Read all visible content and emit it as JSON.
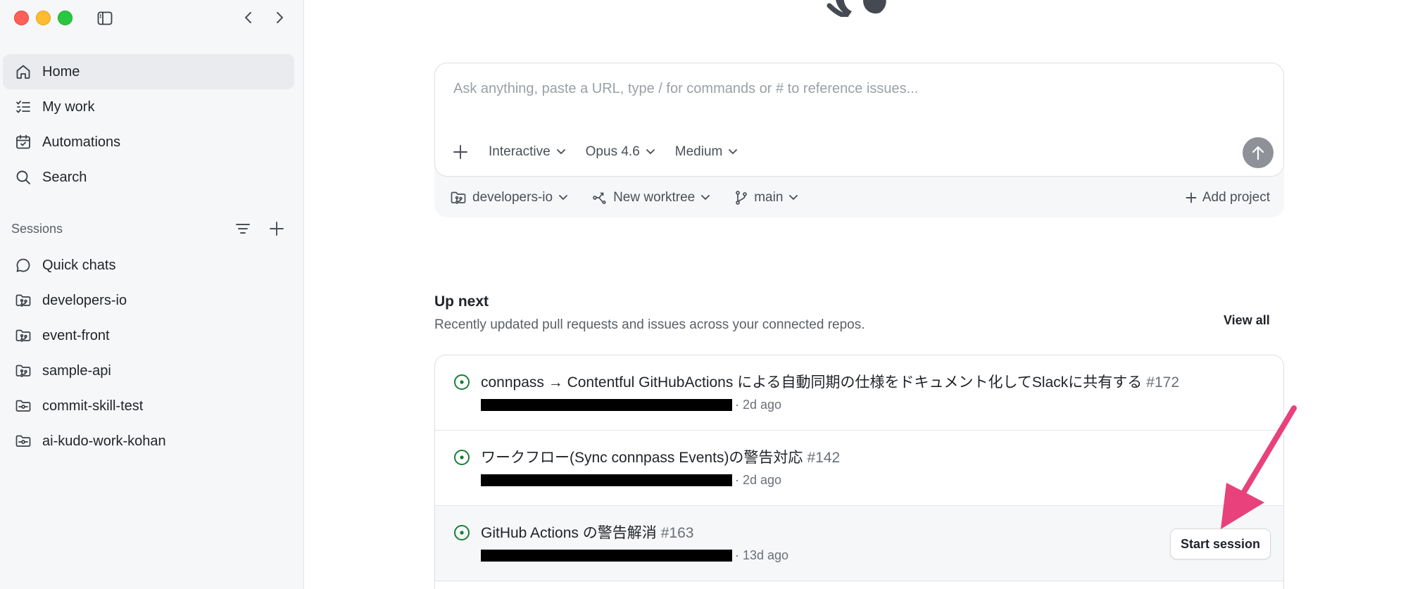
{
  "sidebar": {
    "nav": [
      {
        "label": "Home",
        "icon": "home-icon",
        "active": true
      },
      {
        "label": "My work",
        "icon": "checklist-icon"
      },
      {
        "label": "Automations",
        "icon": "calendar-icon"
      },
      {
        "label": "Search",
        "icon": "search-icon"
      }
    ],
    "sessions_label": "Sessions",
    "sessions": [
      {
        "label": "Quick chats",
        "icon": "chat-bubble-icon"
      },
      {
        "label": "developers-io",
        "icon": "repo-folder-icon"
      },
      {
        "label": "event-front",
        "icon": "repo-folder-icon"
      },
      {
        "label": "sample-api",
        "icon": "repo-folder-icon"
      },
      {
        "label": "commit-skill-test",
        "icon": "commit-folder-icon"
      },
      {
        "label": "ai-kudo-work-kohan",
        "icon": "commit-folder-icon"
      }
    ]
  },
  "composer": {
    "placeholder": "Ask anything, paste a URL, type / for commands or # to reference issues...",
    "mode": "Interactive",
    "model": "Opus 4.6",
    "effort": "Medium",
    "project": "developers-io",
    "worktree": "New worktree",
    "branch": "main",
    "add_project": "Add project"
  },
  "up_next": {
    "title": "Up next",
    "subtitle": "Recently updated pull requests and issues across your connected repos.",
    "view_all": "View all",
    "start_session": "Start session",
    "items": [
      {
        "title": "connpass → Contentful GitHubActions による自動同期の仕様をドキュメント化してSlackに共有する",
        "number": "#172",
        "time": "· 2d ago"
      },
      {
        "title": "ワークフロー(Sync connpass Events)の警告対応",
        "number": "#142",
        "time": "· 2d ago"
      },
      {
        "title": "GitHub Actions の警告解消",
        "number": "#163",
        "time": "· 13d ago"
      }
    ]
  },
  "colors": {
    "accent_arrow": "#e8417b",
    "open_status": "#1a7f37",
    "sidebar_bg": "#f6f7f9"
  }
}
